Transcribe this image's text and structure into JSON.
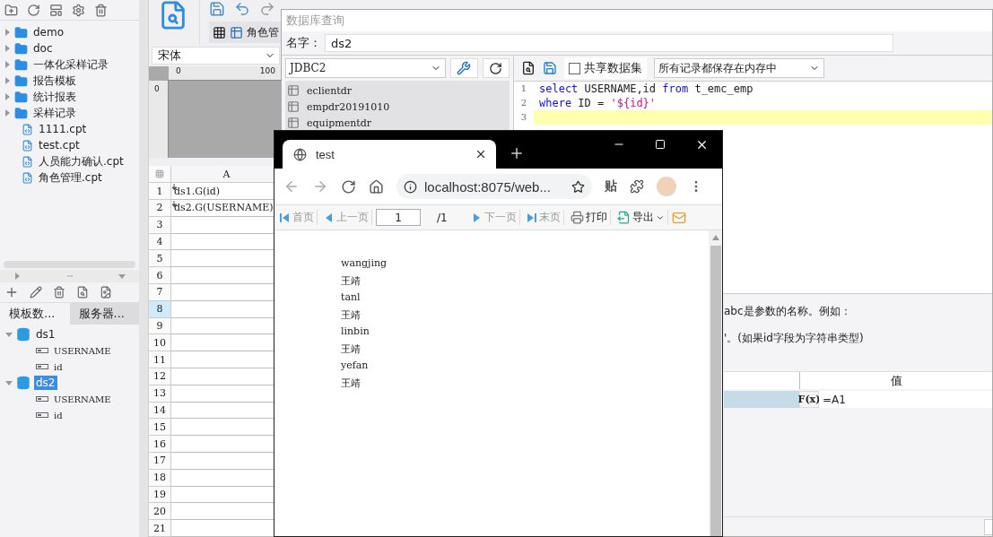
{
  "designer": {
    "file_tree": [
      {
        "label": "demo",
        "kind": "folder"
      },
      {
        "label": "doc",
        "kind": "folder"
      },
      {
        "label": "一体化采样记录",
        "kind": "folder"
      },
      {
        "label": "报告模板",
        "kind": "folder"
      },
      {
        "label": "统计报表",
        "kind": "folder"
      },
      {
        "label": "采样记录",
        "kind": "folder"
      },
      {
        "label": "1111.cpt",
        "kind": "file"
      },
      {
        "label": "test.cpt",
        "kind": "file"
      },
      {
        "label": "人员能力确认.cpt",
        "kind": "file"
      },
      {
        "label": "角色管理.cpt",
        "kind": "file"
      }
    ],
    "dataset_tabs": [
      {
        "label": "模板数...",
        "selected": true
      },
      {
        "label": "服务器...",
        "selected": false
      }
    ],
    "datasets": [
      {
        "name": "ds1",
        "expanded": true,
        "selected": false,
        "children": [
          {
            "name": "USERNAME"
          },
          {
            "name": "id"
          }
        ]
      },
      {
        "name": "ds2",
        "expanded": true,
        "selected": true,
        "children": [
          {
            "name": "USERNAME"
          },
          {
            "name": "id"
          }
        ]
      }
    ],
    "template_tab": {
      "label": "角色管"
    },
    "font_select": {
      "value": "宋体"
    },
    "ruler": {
      "horizontal": [
        "0",
        "100"
      ],
      "vertical": [
        "0"
      ]
    },
    "sheet": {
      "columns": [
        "A"
      ],
      "rows": [
        {
          "number": "1",
          "selected": false,
          "cells": [
            {
              "text": "ds1.G(id)",
              "expands": true
            }
          ]
        },
        {
          "number": "2",
          "selected": false,
          "cells": [
            {
              "text": "ds2.G(USERNAME)",
              "expands": true
            }
          ]
        },
        {
          "number": "3",
          "selected": false,
          "cells": []
        },
        {
          "number": "4",
          "selected": false,
          "cells": []
        },
        {
          "number": "5",
          "selected": false,
          "cells": []
        },
        {
          "number": "6",
          "selected": false,
          "cells": []
        },
        {
          "number": "7",
          "selected": false,
          "cells": []
        },
        {
          "number": "8",
          "selected": true,
          "cells": []
        },
        {
          "number": "9",
          "selected": false,
          "cells": []
        },
        {
          "number": "10",
          "selected": false,
          "cells": []
        },
        {
          "number": "11",
          "selected": false,
          "cells": []
        },
        {
          "number": "12",
          "selected": false,
          "cells": []
        },
        {
          "number": "13",
          "selected": false,
          "cells": []
        },
        {
          "number": "14",
          "selected": false,
          "cells": []
        },
        {
          "number": "15",
          "selected": false,
          "cells": []
        },
        {
          "number": "16",
          "selected": false,
          "cells": []
        },
        {
          "number": "17",
          "selected": false,
          "cells": []
        },
        {
          "number": "18",
          "selected": false,
          "cells": []
        },
        {
          "number": "19",
          "selected": false,
          "cells": []
        },
        {
          "number": "20",
          "selected": false,
          "cells": []
        },
        {
          "number": "21",
          "selected": false,
          "cells": []
        }
      ]
    }
  },
  "query_dialog": {
    "title": "数据库查询",
    "name_label": "名字：",
    "name": "ds2",
    "connection": "JDBC2",
    "tables": [
      "eclientdr",
      "empdr20191010",
      "equipmentdr"
    ],
    "share_dataset": {
      "label": "共享数据集",
      "checked": false
    },
    "storage_mode": "所有记录都保存在内存中",
    "sql_lines": [
      {
        "number": "1",
        "current": false,
        "tokens": [
          {
            "text": "select",
            "kind": "keyword"
          },
          {
            "text": " USERNAME,id ",
            "kind": "plain"
          },
          {
            "text": "from",
            "kind": "keyword"
          },
          {
            "text": " t_emc_emp",
            "kind": "plain"
          }
        ]
      },
      {
        "number": "2",
        "current": false,
        "tokens": [
          {
            "text": "where",
            "kind": "keyword"
          },
          {
            "text": " ID = ",
            "kind": "plain"
          },
          {
            "text": "'${id}'",
            "kind": "string"
          }
        ]
      },
      {
        "number": "3",
        "current": true
      }
    ],
    "help_lines": [
      "abc是参数的名称。例如：",
      "'。(如果id字段为字符串类型)"
    ],
    "params": {
      "columns": [
        "值"
      ],
      "rows": [
        {
          "formula_label": "F(x)",
          "value": "=A1",
          "selected": true
        }
      ]
    }
  },
  "browser": {
    "tab_title": "test",
    "url": "localhost:8075/web...",
    "extension_label": "贴",
    "report_toolbar": [
      {
        "kind": "first",
        "label": "首页",
        "disabled": true
      },
      {
        "kind": "prev",
        "label": "上一页",
        "disabled": true
      },
      {
        "kind": "page",
        "value": "1",
        "total": "/1"
      },
      {
        "kind": "next",
        "label": "下一页",
        "disabled": true
      },
      {
        "kind": "last",
        "label": "末页",
        "disabled": true
      },
      {
        "kind": "print",
        "label": "打印",
        "disabled": false
      },
      {
        "kind": "export",
        "label": "导出",
        "disabled": false
      },
      {
        "kind": "mail"
      }
    ],
    "content_lines": [
      "wangjing",
      "王靖",
      "tanl",
      "王靖",
      "linbin",
      "王靖",
      "yefan",
      "王靖"
    ]
  }
}
